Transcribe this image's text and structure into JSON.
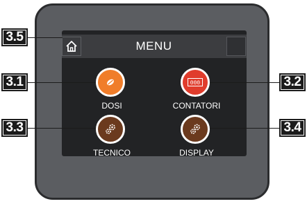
{
  "header": {
    "title": "MENU",
    "home_icon": "home-icon"
  },
  "buttons": [
    {
      "id": "dosi",
      "label": "DOSI",
      "icon": "coffee-bean-icon",
      "color": "#f07d2a"
    },
    {
      "id": "contatori",
      "label": "CONTATORI",
      "icon": "counter-icon",
      "color": "#e03c2c",
      "counter_text": "000"
    },
    {
      "id": "tecnico",
      "label": "TECNICO",
      "icon": "gears-icon",
      "color": "#6b3a1e"
    },
    {
      "id": "display",
      "label": "DISPLAY",
      "icon": "gears-icon",
      "color": "#6b3a1e"
    }
  ],
  "callouts": {
    "home": "3.5",
    "dosi": "3.1",
    "contatori": "3.2",
    "tecnico": "3.3",
    "display": "3.4"
  }
}
